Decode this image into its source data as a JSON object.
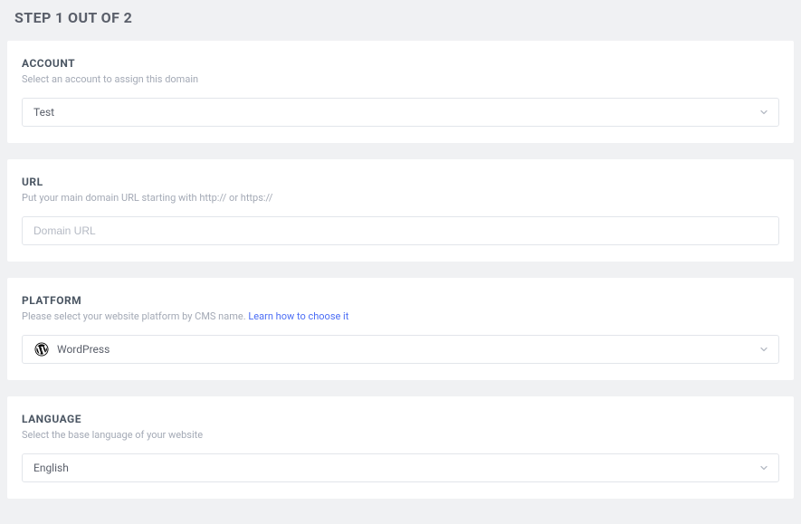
{
  "step_title": "STEP 1 OUT OF 2",
  "account": {
    "label": "ACCOUNT",
    "desc": "Select an account to assign this domain",
    "value": "Test"
  },
  "url": {
    "label": "URL",
    "desc": "Put your main domain URL starting with http:// or https://",
    "placeholder": "Domain URL"
  },
  "platform": {
    "label": "PLATFORM",
    "desc_prefix": "Please select your website platform by CMS name.  ",
    "learn_link": "Learn how to choose it",
    "value": "WordPress"
  },
  "language": {
    "label": "LANGUAGE",
    "desc": "Select the base language of your website",
    "value": "English"
  }
}
